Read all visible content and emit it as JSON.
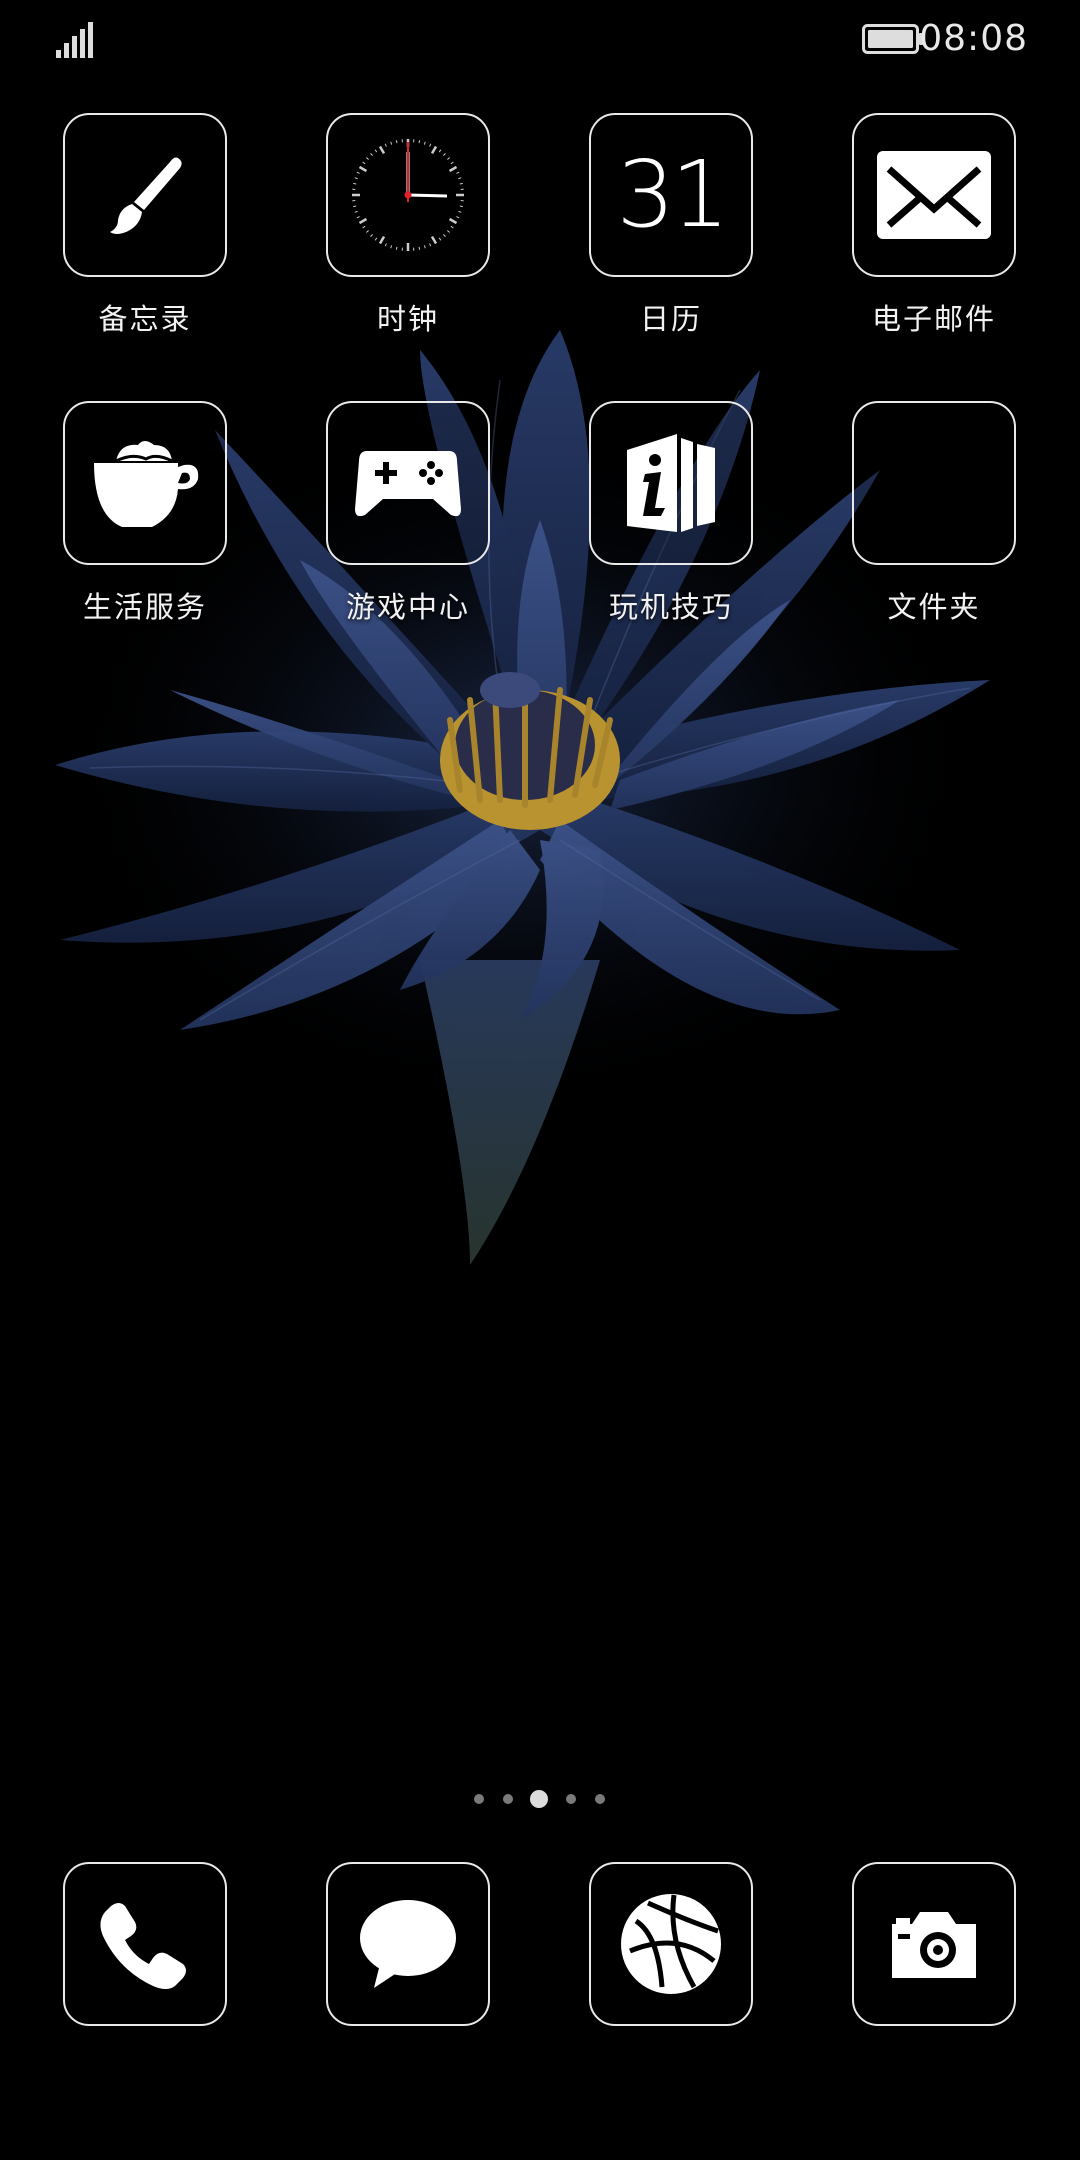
{
  "status_bar": {
    "time": "08:08",
    "signal_icon": "signal-bars-icon",
    "battery_icon": "battery-icon"
  },
  "home": {
    "apps": [
      {
        "label": "备忘录",
        "icon": "paintbrush-icon"
      },
      {
        "label": "时钟",
        "icon": "clock-icon"
      },
      {
        "label": "日历",
        "icon": "calendar-icon",
        "day": "31"
      },
      {
        "label": "电子邮件",
        "icon": "envelope-icon"
      },
      {
        "label": "生活服务",
        "icon": "coffee-cup-icon"
      },
      {
        "label": "游戏中心",
        "icon": "gamepad-icon"
      },
      {
        "label": "玩机技巧",
        "icon": "info-book-icon"
      },
      {
        "label": "文件夹",
        "icon": "folder-icon"
      }
    ],
    "page_indicator": {
      "total": 5,
      "active_index": 2
    }
  },
  "dock": [
    {
      "icon": "phone-icon"
    },
    {
      "icon": "message-bubble-icon"
    },
    {
      "icon": "browser-globe-icon"
    },
    {
      "icon": "camera-icon"
    }
  ],
  "colors": {
    "background": "#000000",
    "tile_border": "#e9e9e9",
    "petal": "#2a3d66",
    "stamen": "#c9a534",
    "clock_hand_second": "#e0202a"
  }
}
